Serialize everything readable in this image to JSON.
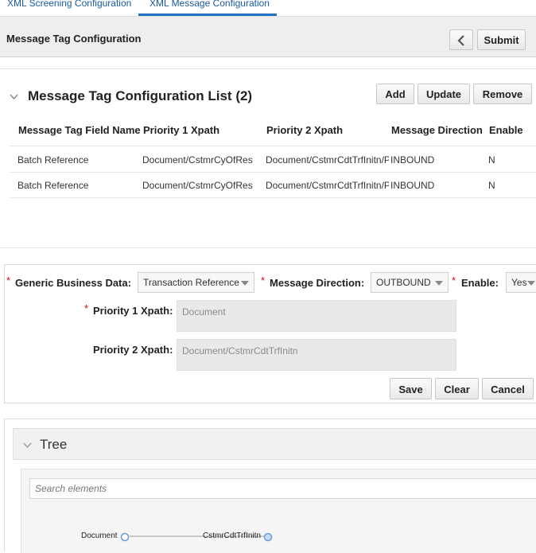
{
  "tabs": [
    {
      "label": "XML Screening Configuration",
      "active": false
    },
    {
      "label": "XML Message Configuration",
      "active": true
    }
  ],
  "header": {
    "title": "Message Tag Configuration",
    "submit_label": "Submit"
  },
  "list": {
    "title": "Message Tag Configuration List (2)",
    "add_label": "Add",
    "update_label": "Update",
    "remove_label": "Remove",
    "columns": [
      "Message Tag Field Name",
      "Priority 1 Xpath",
      "Priority 2 Xpath",
      "Message Direction",
      "Enable"
    ],
    "rows": [
      [
        "Batch Reference",
        "Document/CstmrCyOfRes",
        "Document/CstmrCdtTrfInitn/P",
        "INBOUND",
        "N"
      ],
      [
        "Batch Reference",
        "Document/CstmrCyOfRes",
        "Document/CstmrCdtTrfInitn/P",
        "INBOUND",
        "N"
      ]
    ]
  },
  "form": {
    "required_mark": "*",
    "generic_label": "Generic Business Data:",
    "generic_value": "Transaction Reference",
    "direction_label": "Message Direction:",
    "direction_value": "OUTBOUND",
    "enable_label": "Enable:",
    "enable_value": "Yes",
    "p1_label": "Priority 1 Xpath:",
    "p1_value": "Document",
    "p2_label": "Priority 2 Xpath:",
    "p2_value": "Document/CstmrCdtTrfInitn",
    "save_label": "Save",
    "clear_label": "Clear",
    "cancel_label": "Cancel"
  },
  "tree": {
    "title": "Tree",
    "search_placeholder": "Search elements",
    "nodes": [
      "Document",
      "CstmrCdtTrfInitn"
    ]
  },
  "colors": {
    "accent": "#1e73be",
    "link": "#1a5aa0",
    "required": "#d0021b",
    "node": "#6a9bd8"
  }
}
